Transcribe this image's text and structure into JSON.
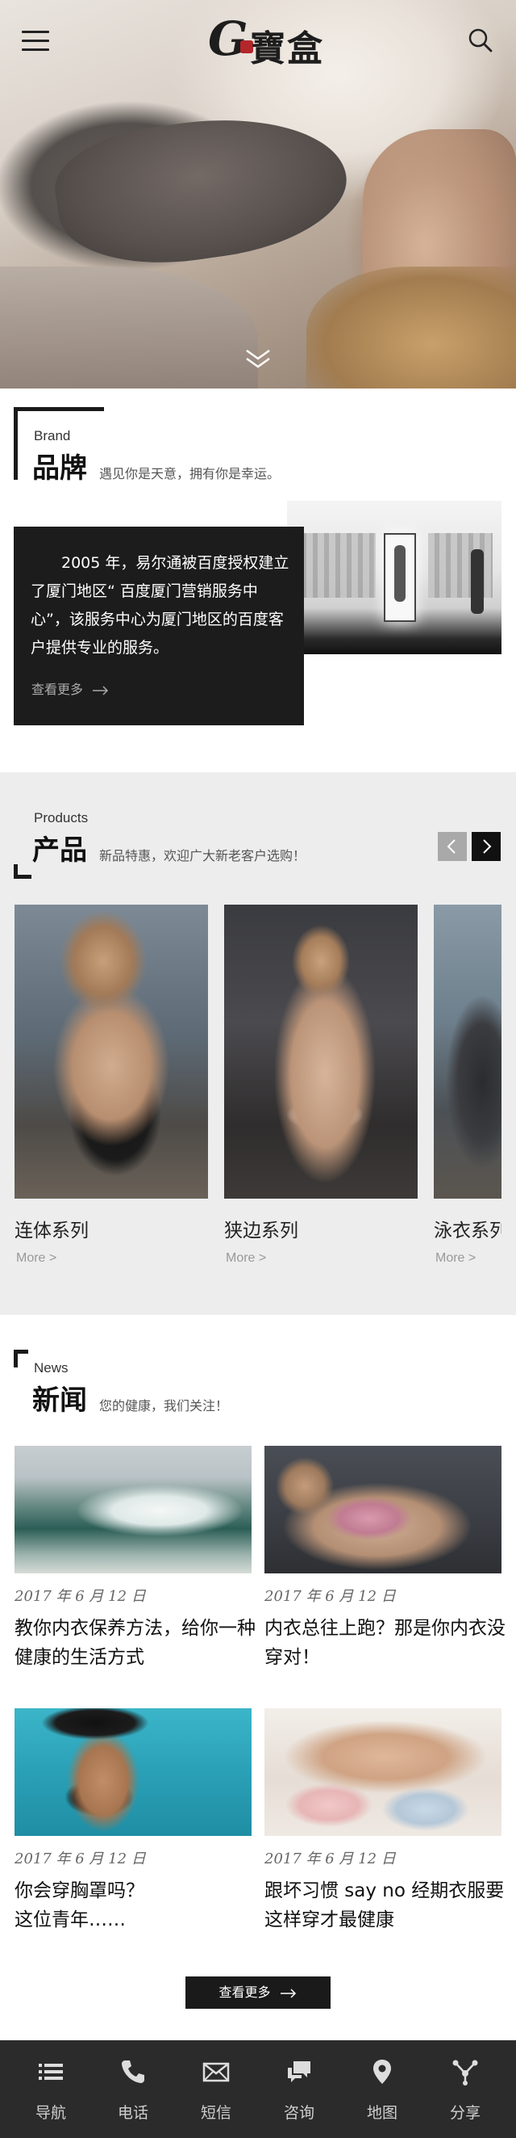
{
  "header": {
    "logo_letter": "G",
    "logo_text": "寶盒"
  },
  "brand": {
    "title_en": "Brand",
    "title_cn": "品牌",
    "subtitle": "遇见你是天意，拥有你是幸运。",
    "description": "2005 年，易尔通被百度授权建立了厦门地区“ 百度厦门营销服务中心”，该服务中心为厦门地区的百度客户提供专业的服务。",
    "more_label": "查看更多"
  },
  "products": {
    "title_en": "Products",
    "title_cn": "产品",
    "subtitle": "新品特惠，欢迎广大新老客户选购！",
    "items": [
      {
        "name": "连体系列",
        "more": "More >"
      },
      {
        "name": "狭边系列",
        "more": "More >"
      },
      {
        "name": "泳衣系列",
        "more": "More >"
      }
    ]
  },
  "news": {
    "title_en": "News",
    "title_cn": "新闻",
    "subtitle": "您的健康，我们关注！",
    "items": [
      {
        "date": "2017 年 6 月 12 日",
        "title": "教你内衣保养方法，给你一种健康的生活方式"
      },
      {
        "date": "2017 年 6 月 12 日",
        "title": "内衣总往上跑？那是你内衣没穿对！"
      },
      {
        "date": "2017 年 6 月 12 日",
        "title": "你会穿胸罩吗？\n这位青年……"
      },
      {
        "date": "2017 年 6 月 12 日",
        "title": "跟坏习惯 say no 经期衣服要这样穿才最健康"
      }
    ],
    "more_label": "查看更多"
  },
  "bottom_nav": [
    {
      "label": "导航",
      "icon": "list-icon"
    },
    {
      "label": "电话",
      "icon": "phone-icon"
    },
    {
      "label": "短信",
      "icon": "mail-icon"
    },
    {
      "label": "咨询",
      "icon": "chat-icon"
    },
    {
      "label": "地图",
      "icon": "map-pin-icon"
    },
    {
      "label": "分享",
      "icon": "share-icon"
    }
  ],
  "colors": {
    "dark": "#1c1c1c",
    "section_gray": "#ededed",
    "nav_bg": "#2b2b2b",
    "seal_red": "#b3262a"
  }
}
